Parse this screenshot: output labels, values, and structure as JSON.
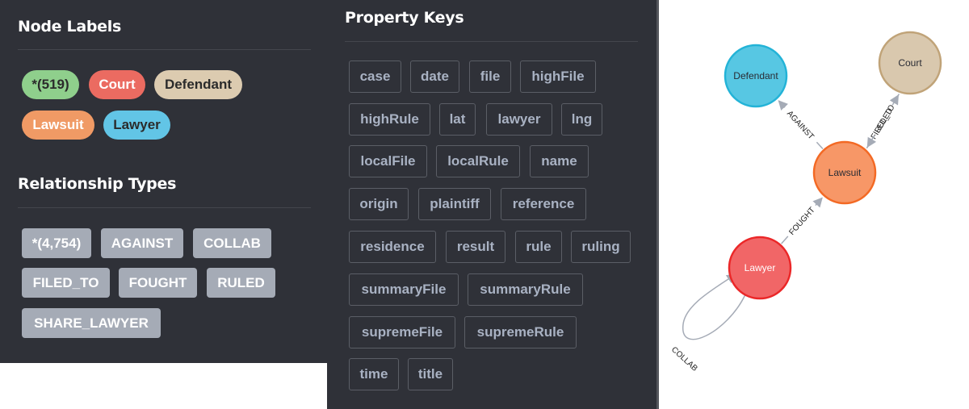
{
  "node_labels": {
    "title": "Node Labels",
    "items": [
      {
        "label": "*(519)",
        "bg": "#8fcf8c",
        "fg": "#2b2b2b"
      },
      {
        "label": "Court",
        "bg": "#eb6b61",
        "fg": "#ffffff"
      },
      {
        "label": "Defendant",
        "bg": "#dccbb0",
        "fg": "#2b2b2b"
      },
      {
        "label": "Lawsuit",
        "bg": "#f09a65",
        "fg": "#ffffff"
      },
      {
        "label": "Lawyer",
        "bg": "#62c5e6",
        "fg": "#2b2b2b"
      }
    ]
  },
  "relationship_types": {
    "title": "Relationship Types",
    "items": [
      "*(4,754)",
      "AGAINST",
      "COLLAB",
      "FILED_TO",
      "FOUGHT",
      "RULED",
      "SHARE_LAWYER"
    ]
  },
  "property_keys": {
    "title": "Property Keys",
    "items": [
      "case",
      "date",
      "file",
      "highFile",
      "highRule",
      "lat",
      "lawyer",
      "lng",
      "localFile",
      "localRule",
      "name",
      "origin",
      "plaintiff",
      "reference",
      "residence",
      "result",
      "rule",
      "ruling",
      "summaryFile",
      "summaryRule",
      "supremeFile",
      "supremeRule",
      "time",
      "title"
    ]
  },
  "graph": {
    "nodes": [
      {
        "id": "defendant",
        "label": "Defendant",
        "fill": "#57c7e3",
        "stroke": "#23b3d7",
        "text": "#2a2c34"
      },
      {
        "id": "court",
        "label": "Court",
        "fill": "#d9c8ae",
        "stroke": "#c0a378",
        "text": "#2a2c34"
      },
      {
        "id": "lawsuit",
        "label": "Lawsuit",
        "fill": "#f79767",
        "stroke": "#f36924",
        "text": "#2a2c34"
      },
      {
        "id": "lawyer",
        "label": "Lawyer",
        "fill": "#f16667",
        "stroke": "#eb2728",
        "text": "#ffffff"
      }
    ],
    "edges": [
      {
        "from": "lawsuit",
        "to": "defendant",
        "label": "AGAINST"
      },
      {
        "from": "lawsuit",
        "to": "court",
        "label": "FILED_TO"
      },
      {
        "from": "court",
        "to": "lawsuit",
        "label": "RULED"
      },
      {
        "from": "lawyer",
        "to": "lawsuit",
        "label": "FOUGHT"
      },
      {
        "from": "lawyer",
        "to": "lawyer",
        "label": "COLLAB"
      }
    ]
  }
}
